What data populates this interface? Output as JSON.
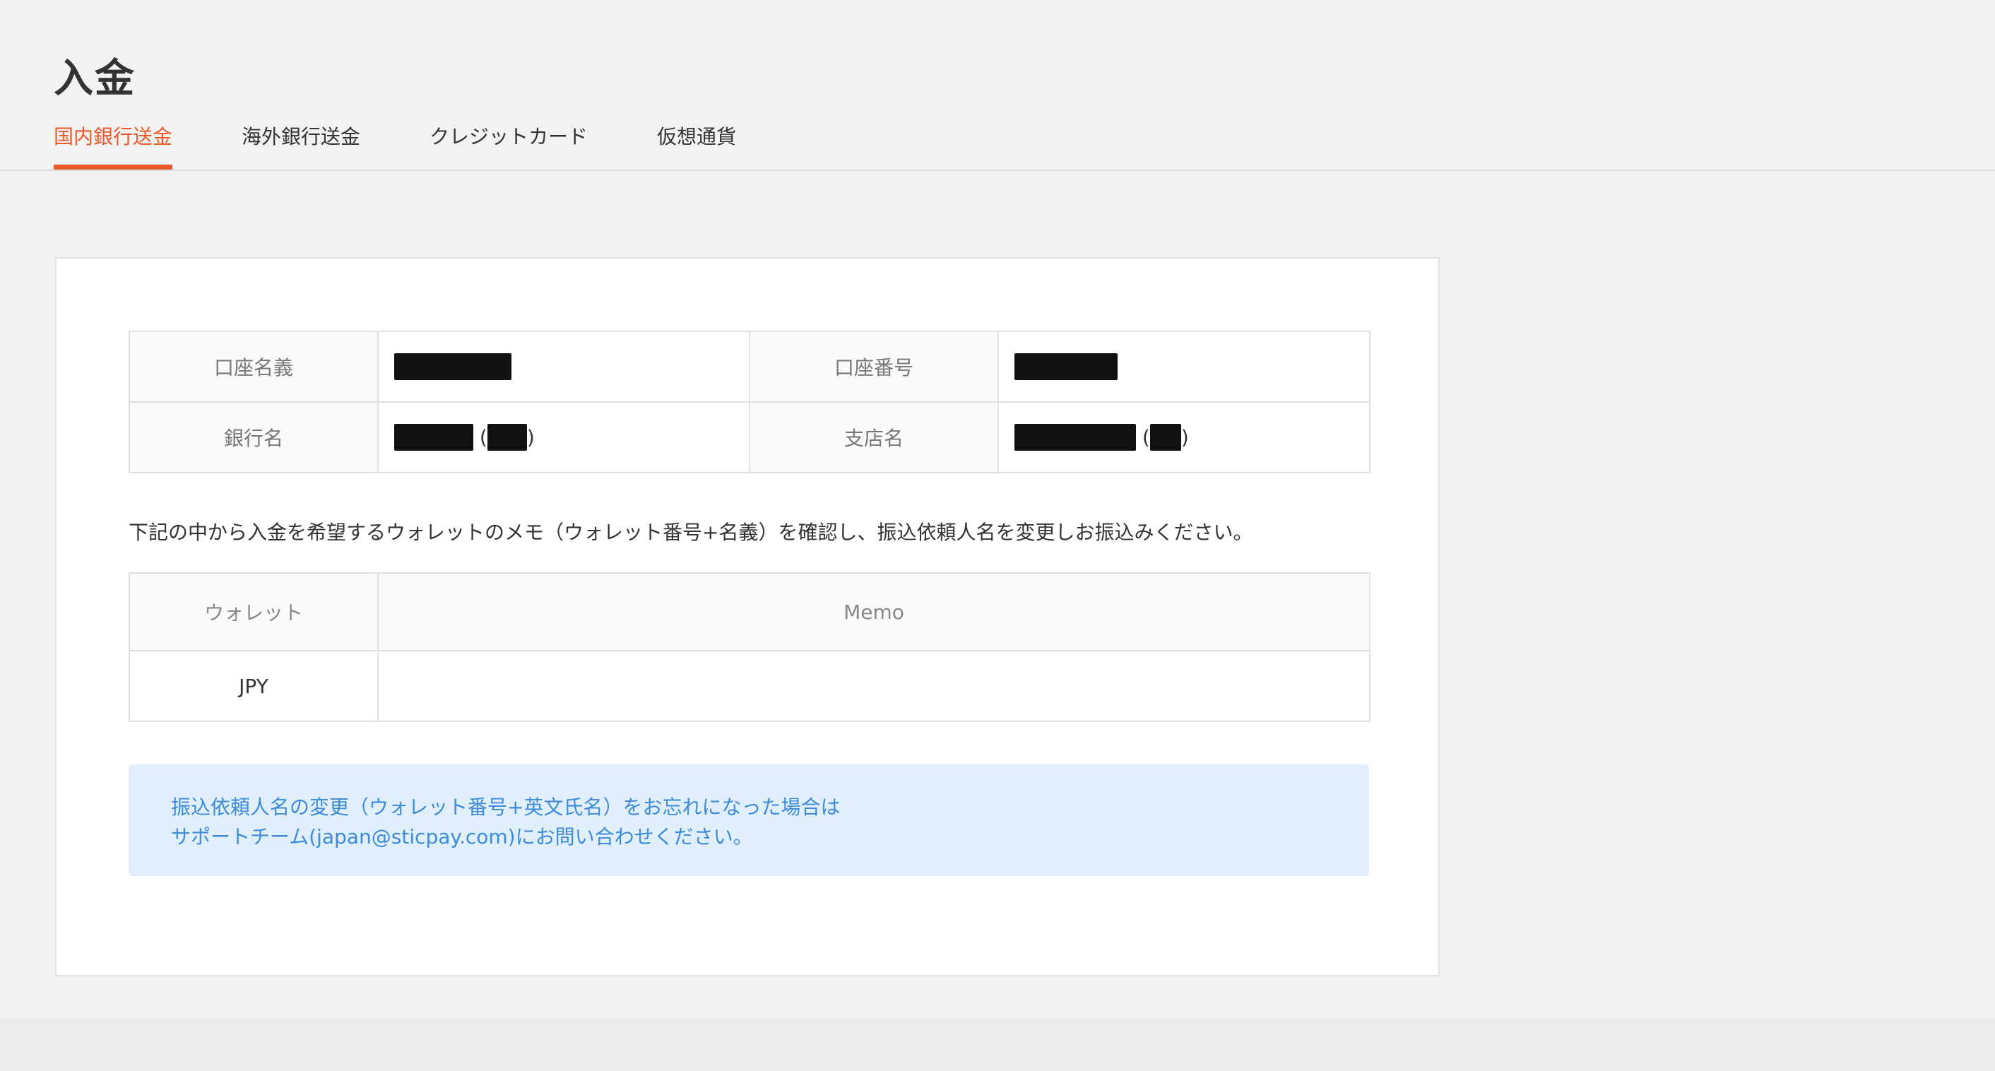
{
  "page": {
    "title": "入金"
  },
  "tabs": [
    {
      "label": "国内銀行送金",
      "active": true
    },
    {
      "label": "海外銀行送金",
      "active": false
    },
    {
      "label": "クレジットカード",
      "active": false
    },
    {
      "label": "仮想通貨",
      "active": false
    }
  ],
  "bank_info": {
    "account_name_label": "口座名義",
    "account_number_label": "口座番号",
    "bank_name_label": "銀行名",
    "branch_name_label": "支店名",
    "paren_open": "(",
    "paren_close": ")"
  },
  "instruction": "下記の中から入金を希望するウォレットのメモ（ウォレット番号+名義）を確認し、振込依頼人名を変更しお振込みください。",
  "wallet_table": {
    "headers": [
      "ウォレット",
      "Memo"
    ],
    "rows": [
      {
        "wallet": "JPY",
        "memo": ""
      }
    ]
  },
  "notice": {
    "line1": "振込依頼人名の変更（ウォレット番号+英文氏名）をお忘れになった場合は",
    "line2": "サポートチーム(japan@sticpay.com)にお問い合わせください。"
  },
  "colors": {
    "accent": "#ea5a2b",
    "notice_bg": "#e1eefc",
    "notice_text": "#3d8bd9"
  }
}
